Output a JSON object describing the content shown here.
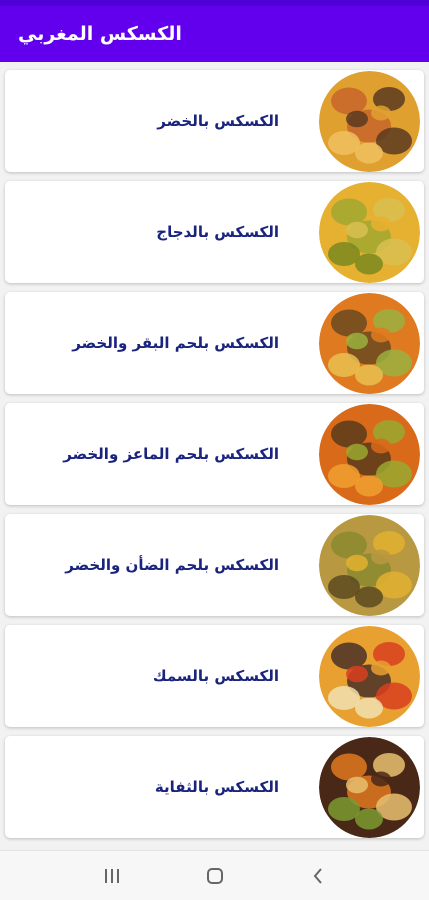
{
  "app": {
    "title": "الكسكس المغربي"
  },
  "items": [
    {
      "label": "الكسكس بالخضر",
      "thumb_icon": "couscous-vegetables-image",
      "colors": [
        "#e0a030",
        "#c8652a",
        "#5a3a20",
        "#f0c060"
      ]
    },
    {
      "label": "الكسكس بالدجاج",
      "thumb_icon": "couscous-chicken-image",
      "colors": [
        "#e6b030",
        "#a0a830",
        "#d8c050",
        "#7a8a20"
      ]
    },
    {
      "label": "الكسكس بلحم البقر والخضر",
      "thumb_icon": "couscous-beef-image",
      "colors": [
        "#e07a20",
        "#6a4a20",
        "#9ab040",
        "#e8c050"
      ]
    },
    {
      "label": "الكسكس بلحم الماعز والخضر",
      "thumb_icon": "couscous-goat-image",
      "colors": [
        "#d86a1a",
        "#5a3a1a",
        "#9aa830",
        "#f0a030"
      ]
    },
    {
      "label": "الكسكس بلحم الضأن والخضر",
      "thumb_icon": "couscous-lamb-image",
      "colors": [
        "#b89840",
        "#8a8a30",
        "#e0b030",
        "#5a4a20"
      ]
    },
    {
      "label": "الكسكس بالسمك",
      "thumb_icon": "couscous-fish-image",
      "colors": [
        "#e8a030",
        "#4a3028",
        "#d84020",
        "#f0e0b0"
      ]
    },
    {
      "label": "الكسكس بالثفاية",
      "thumb_icon": "couscous-tfaya-image",
      "colors": [
        "#4a2818",
        "#e07820",
        "#e8c070",
        "#7a9a30"
      ]
    }
  ],
  "nav": {
    "recents_icon": "recents-icon",
    "home_icon": "home-icon",
    "back_icon": "back-icon"
  }
}
